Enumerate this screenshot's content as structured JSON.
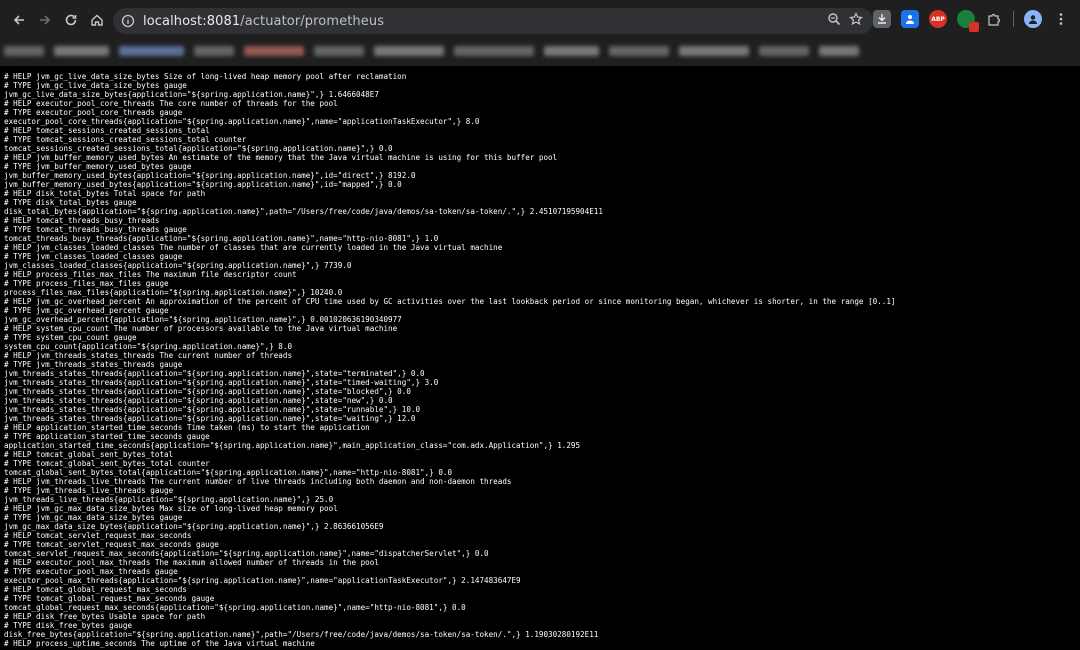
{
  "browser": {
    "url": "localhost:8081/actuator/prometheus",
    "url_host": "localhost:8081",
    "url_path": "/actuator/prometheus",
    "extensions": [
      "download-icon",
      "contacts-icon",
      "ABP",
      "tracker-icon",
      "puzzle-icon",
      "profile-avatar",
      "menu-icon"
    ]
  },
  "content_lines": [
    "# HELP jvm_gc_live_data_size_bytes Size of long-lived heap memory pool after reclamation",
    "# TYPE jvm_gc_live_data_size_bytes gauge",
    "jvm_gc_live_data_size_bytes{application=\"${spring.application.name}\",} 1.6466048E7",
    "# HELP executor_pool_core_threads The core number of threads for the pool",
    "# TYPE executor_pool_core_threads gauge",
    "executor_pool_core_threads{application=\"${spring.application.name}\",name=\"applicationTaskExecutor\",} 8.0",
    "# HELP tomcat_sessions_created_sessions_total",
    "# TYPE tomcat_sessions_created_sessions_total counter",
    "tomcat_sessions_created_sessions_total{application=\"${spring.application.name}\",} 0.0",
    "# HELP jvm_buffer_memory_used_bytes An estimate of the memory that the Java virtual machine is using for this buffer pool",
    "# TYPE jvm_buffer_memory_used_bytes gauge",
    "jvm_buffer_memory_used_bytes{application=\"${spring.application.name}\",id=\"direct\",} 8192.0",
    "jvm_buffer_memory_used_bytes{application=\"${spring.application.name}\",id=\"mapped\",} 0.0",
    "# HELP disk_total_bytes Total space for path",
    "# TYPE disk_total_bytes gauge",
    "disk_total_bytes{application=\"${spring.application.name}\",path=\"/Users/free/code/java/demos/sa-token/sa-token/.\",} 2.45107195904E11",
    "# HELP tomcat_threads_busy_threads",
    "# TYPE tomcat_threads_busy_threads gauge",
    "tomcat_threads_busy_threads{application=\"${spring.application.name}\",name=\"http-nio-8081\",} 1.0",
    "# HELP jvm_classes_loaded_classes The number of classes that are currently loaded in the Java virtual machine",
    "# TYPE jvm_classes_loaded_classes gauge",
    "jvm_classes_loaded_classes{application=\"${spring.application.name}\",} 7739.0",
    "# HELP process_files_max_files The maximum file descriptor count",
    "# TYPE process_files_max_files gauge",
    "process_files_max_files{application=\"${spring.application.name}\",} 10240.0",
    "# HELP jvm_gc_overhead_percent An approximation of the percent of CPU time used by GC activities over the last lookback period or since monitoring began, whichever is shorter, in the range [0..1]",
    "# TYPE jvm_gc_overhead_percent gauge",
    "jvm_gc_overhead_percent{application=\"${spring.application.name}\",} 0.001020636190340977",
    "# HELP system_cpu_count The number of processors available to the Java virtual machine",
    "# TYPE system_cpu_count gauge",
    "system_cpu_count{application=\"${spring.application.name}\",} 8.0",
    "# HELP jvm_threads_states_threads The current number of threads",
    "# TYPE jvm_threads_states_threads gauge",
    "jvm_threads_states_threads{application=\"${spring.application.name}\",state=\"terminated\",} 0.0",
    "jvm_threads_states_threads{application=\"${spring.application.name}\",state=\"timed-waiting\",} 3.0",
    "jvm_threads_states_threads{application=\"${spring.application.name}\",state=\"blocked\",} 0.0",
    "jvm_threads_states_threads{application=\"${spring.application.name}\",state=\"new\",} 0.0",
    "jvm_threads_states_threads{application=\"${spring.application.name}\",state=\"runnable\",} 10.0",
    "jvm_threads_states_threads{application=\"${spring.application.name}\",state=\"waiting\",} 12.0",
    "# HELP application_started_time_seconds Time taken (ms) to start the application",
    "# TYPE application_started_time_seconds gauge",
    "application_started_time_seconds{application=\"${spring.application.name}\",main_application_class=\"com.adx.Application\",} 1.295",
    "# HELP tomcat_global_sent_bytes_total",
    "# TYPE tomcat_global_sent_bytes_total counter",
    "tomcat_global_sent_bytes_total{application=\"${spring.application.name}\",name=\"http-nio-8081\",} 0.0",
    "# HELP jvm_threads_live_threads The current number of live threads including both daemon and non-daemon threads",
    "# TYPE jvm_threads_live_threads gauge",
    "jvm_threads_live_threads{application=\"${spring.application.name}\",} 25.0",
    "# HELP jvm_gc_max_data_size_bytes Max size of long-lived heap memory pool",
    "# TYPE jvm_gc_max_data_size_bytes gauge",
    "jvm_gc_max_data_size_bytes{application=\"${spring.application.name}\",} 2.863661056E9",
    "# HELP tomcat_servlet_request_max_seconds",
    "# TYPE tomcat_servlet_request_max_seconds gauge",
    "tomcat_servlet_request_max_seconds{application=\"${spring.application.name}\",name=\"dispatcherServlet\",} 0.0",
    "# HELP executor_pool_max_threads The maximum allowed number of threads in the pool",
    "# TYPE executor_pool_max_threads gauge",
    "executor_pool_max_threads{application=\"${spring.application.name}\",name=\"applicationTaskExecutor\",} 2.147483647E9",
    "# HELP tomcat_global_request_max_seconds",
    "# TYPE tomcat_global_request_max_seconds gauge",
    "tomcat_global_request_max_seconds{application=\"${spring.application.name}\",name=\"http-nio-8081\",} 0.0",
    "# HELP disk_free_bytes Usable space for path",
    "# TYPE disk_free_bytes gauge",
    "disk_free_bytes{application=\"${spring.application.name}\",path=\"/Users/free/code/java/demos/sa-token/sa-token/.\",} 1.19030280192E11",
    "# HELP process_uptime_seconds The uptime of the Java virtual machine"
  ]
}
